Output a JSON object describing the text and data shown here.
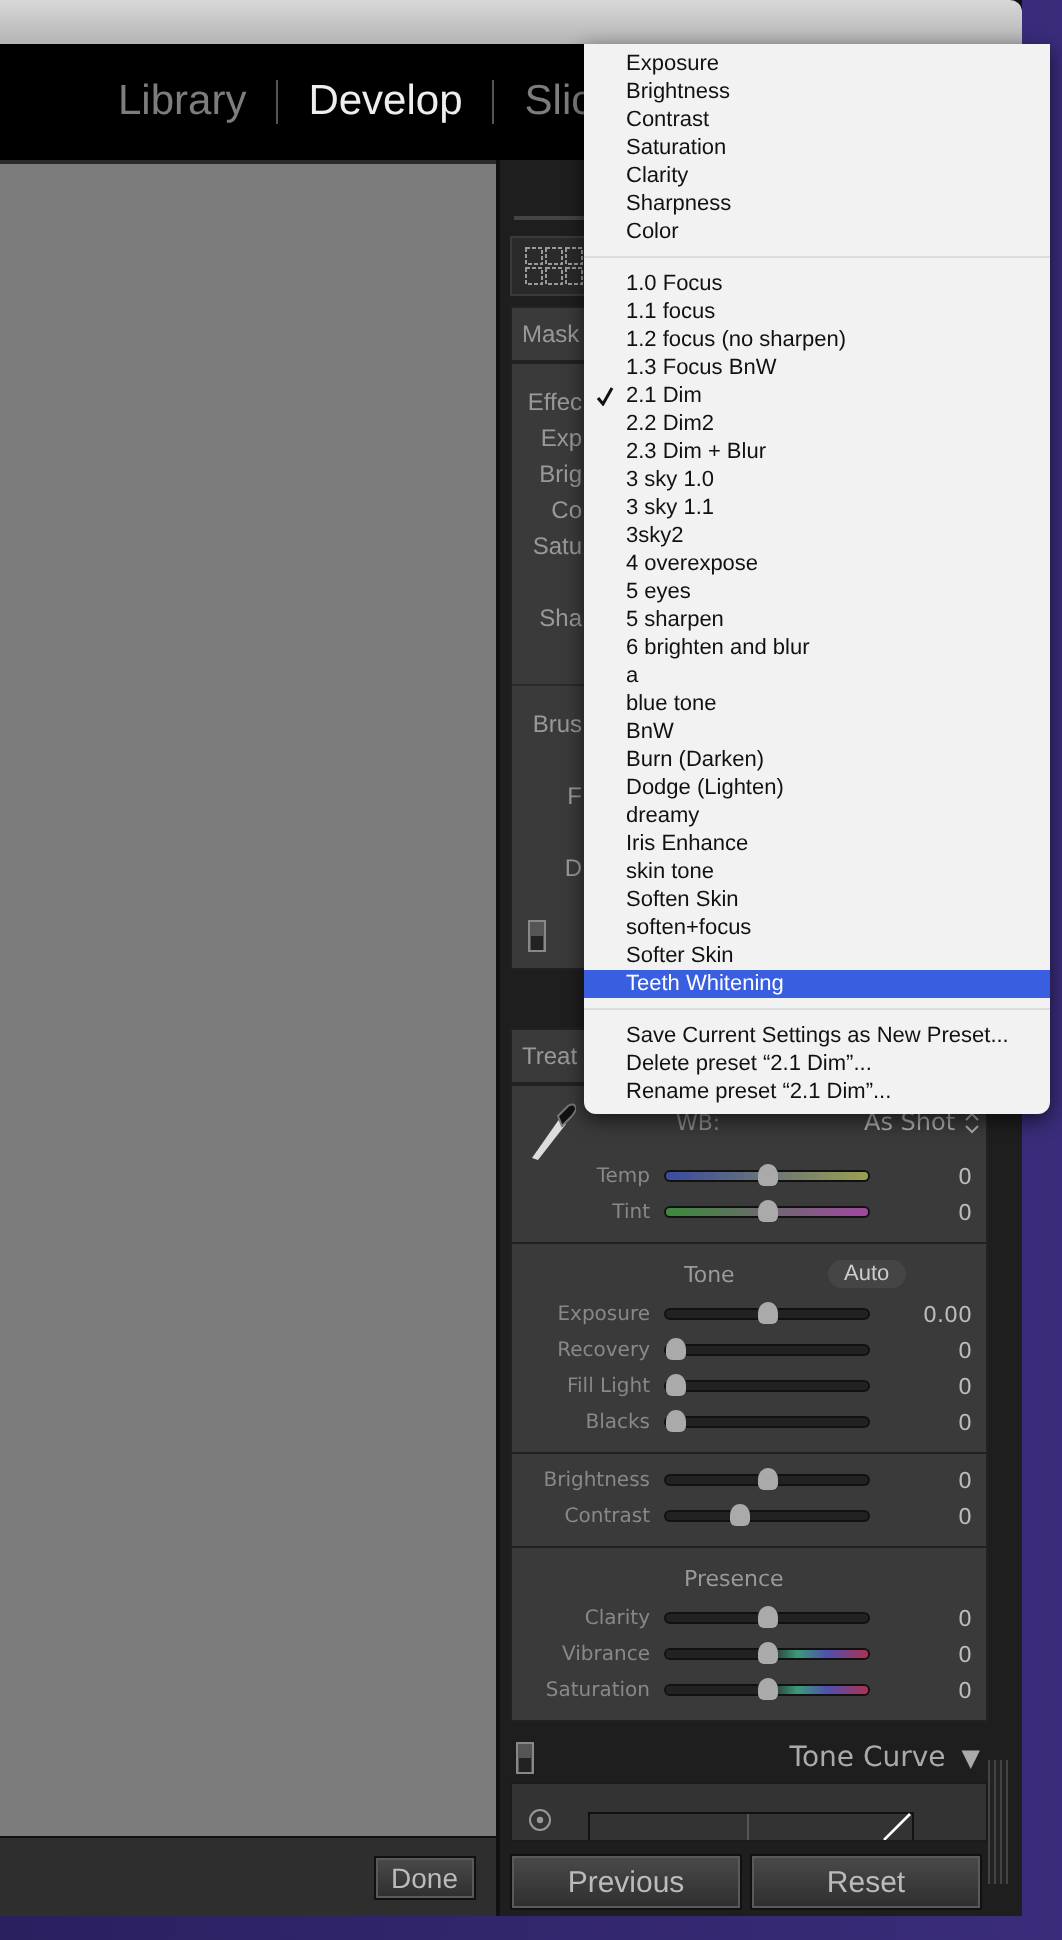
{
  "modules": [
    {
      "label": "Library",
      "selected": false
    },
    {
      "label": "Develop",
      "selected": true
    },
    {
      "label": "Slic",
      "selected": false
    }
  ],
  "toolbar": {
    "done_button": "Done"
  },
  "brush_panel": {
    "header": "Mask",
    "labels": [
      "Effec",
      "Exp",
      "Brig",
      "Co",
      "Satu"
    ],
    "labels_lower": [
      "Sha"
    ],
    "brush_header": "Brus",
    "brush_labels": [
      "F",
      "D"
    ]
  },
  "basic_panel": {
    "header": "Treat",
    "wb": {
      "label": "WB:",
      "value": "As Shot"
    },
    "groups": [
      {
        "sliders": [
          {
            "label": "Temp",
            "value": "0",
            "level": 0.5,
            "kind": "temp"
          },
          {
            "label": "Tint",
            "value": "0",
            "level": 0.5,
            "kind": "tint"
          }
        ]
      },
      {
        "title": "Tone",
        "button": "Auto",
        "sliders": [
          {
            "label": "Exposure",
            "value": "0.00",
            "level": 0.5,
            "kind": "plain"
          },
          {
            "label": "Recovery",
            "value": "0",
            "level": 0,
            "kind": "plain"
          },
          {
            "label": "Fill Light",
            "value": "0",
            "level": 0,
            "kind": "plain"
          },
          {
            "label": "Blacks",
            "value": "0",
            "level": 0,
            "kind": "plain"
          }
        ]
      },
      {
        "sliders": [
          {
            "label": "Brightness",
            "value": "0",
            "level": 0.5,
            "kind": "plain"
          },
          {
            "label": "Contrast",
            "value": "0",
            "level": 0.35,
            "kind": "plain"
          }
        ]
      },
      {
        "title": "Presence",
        "sliders": [
          {
            "label": "Clarity",
            "value": "0",
            "level": 0.5,
            "kind": "plain"
          },
          {
            "label": "Vibrance",
            "value": "0",
            "level": 0.5,
            "kind": "color"
          },
          {
            "label": "Saturation",
            "value": "0",
            "level": 0.5,
            "kind": "color"
          }
        ]
      }
    ]
  },
  "tone_curve": {
    "header": "Tone Curve",
    "toggle": "▼"
  },
  "buttons": [
    "Previous",
    "Reset"
  ],
  "menu": {
    "sections": [
      [
        {
          "label": "Exposure",
          "checked": false,
          "selected": false
        },
        {
          "label": "Brightness",
          "checked": false,
          "selected": false
        },
        {
          "label": "Contrast",
          "checked": false,
          "selected": false
        },
        {
          "label": "Saturation",
          "checked": false,
          "selected": false
        },
        {
          "label": "Clarity",
          "checked": false,
          "selected": false
        },
        {
          "label": "Sharpness",
          "checked": false,
          "selected": false
        },
        {
          "label": "Color",
          "checked": false,
          "selected": false
        }
      ],
      [
        {
          "label": "1.0 Focus",
          "checked": false,
          "selected": false
        },
        {
          "label": "1.1 focus",
          "checked": false,
          "selected": false
        },
        {
          "label": "1.2 focus (no sharpen)",
          "checked": false,
          "selected": false
        },
        {
          "label": "1.3 Focus BnW",
          "checked": false,
          "selected": false
        },
        {
          "label": "2.1 Dim",
          "checked": true,
          "selected": false
        },
        {
          "label": "2.2 Dim2",
          "checked": false,
          "selected": false
        },
        {
          "label": "2.3 Dim + Blur",
          "checked": false,
          "selected": false
        },
        {
          "label": "3 sky 1.0",
          "checked": false,
          "selected": false
        },
        {
          "label": "3 sky 1.1",
          "checked": false,
          "selected": false
        },
        {
          "label": "3sky2",
          "checked": false,
          "selected": false
        },
        {
          "label": "4 overexpose",
          "checked": false,
          "selected": false
        },
        {
          "label": "5 eyes",
          "checked": false,
          "selected": false
        },
        {
          "label": "5 sharpen",
          "checked": false,
          "selected": false
        },
        {
          "label": "6 brighten and blur",
          "checked": false,
          "selected": false
        },
        {
          "label": "a",
          "checked": false,
          "selected": false
        },
        {
          "label": "blue tone",
          "checked": false,
          "selected": false
        },
        {
          "label": "BnW",
          "checked": false,
          "selected": false
        },
        {
          "label": "Burn (Darken)",
          "checked": false,
          "selected": false
        },
        {
          "label": "Dodge (Lighten)",
          "checked": false,
          "selected": false
        },
        {
          "label": "dreamy",
          "checked": false,
          "selected": false
        },
        {
          "label": "Iris Enhance",
          "checked": false,
          "selected": false
        },
        {
          "label": "skin tone",
          "checked": false,
          "selected": false
        },
        {
          "label": "Soften Skin",
          "checked": false,
          "selected": false
        },
        {
          "label": "soften+focus",
          "checked": false,
          "selected": false
        },
        {
          "label": "Softer Skin",
          "checked": false,
          "selected": false
        },
        {
          "label": "Teeth Whitening",
          "checked": false,
          "selected": true
        }
      ],
      [
        {
          "label": "Save Current Settings as New Preset...",
          "checked": false,
          "selected": false
        },
        {
          "label": "Delete preset “2.1 Dim”...",
          "checked": false,
          "selected": false
        },
        {
          "label": "Rename preset “2.1 Dim”...",
          "checked": false,
          "selected": false
        }
      ]
    ]
  }
}
